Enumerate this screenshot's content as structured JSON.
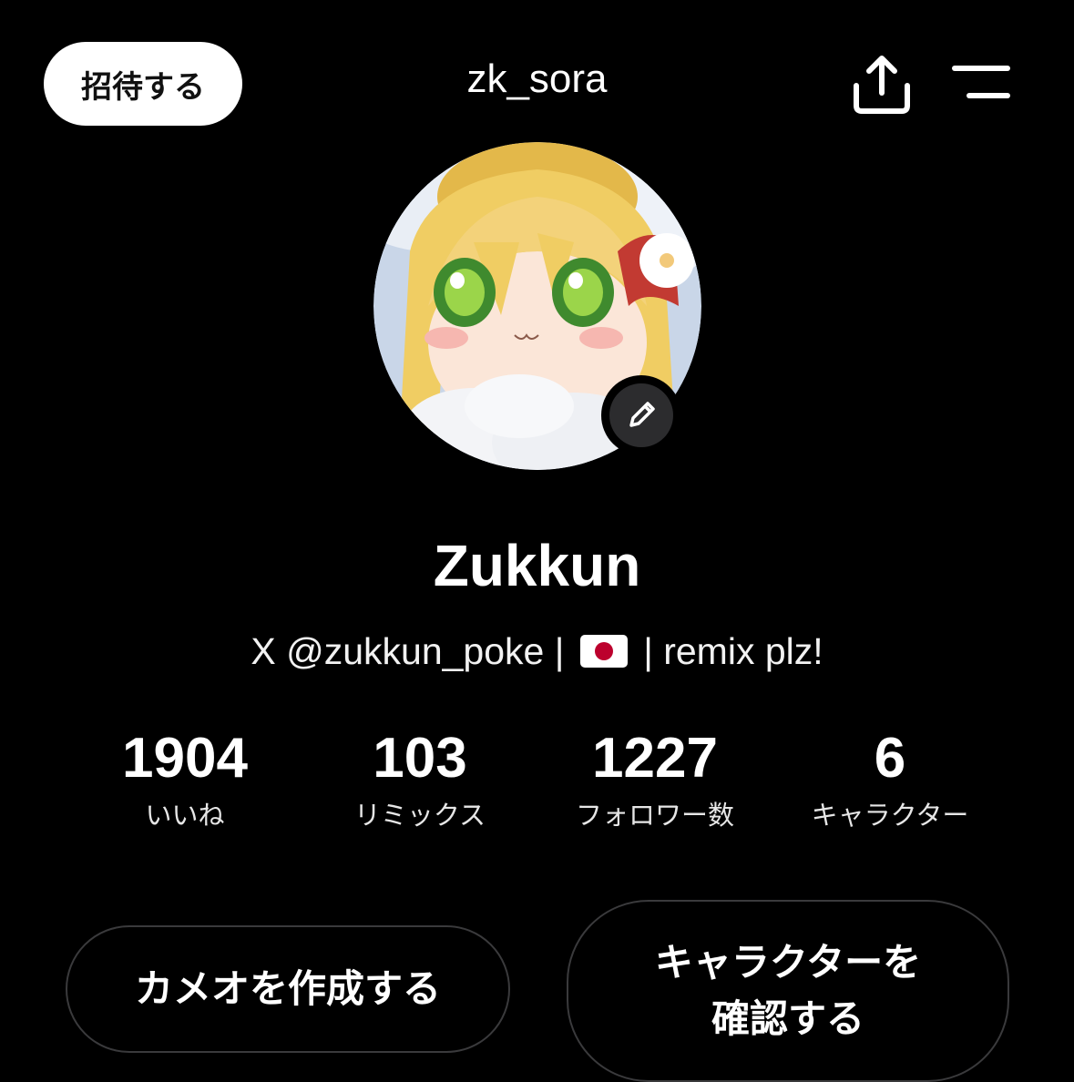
{
  "header": {
    "invite_label": "招待する",
    "username": "zk_sora",
    "share_icon": "share-icon",
    "menu_icon": "menu-icon"
  },
  "profile": {
    "display_name": "Zukkun",
    "bio_prefix": "X @zukkun_poke |",
    "bio_flag": "japan-flag-icon",
    "bio_suffix": "| remix plz!",
    "avatar": "anime-girl-avatar",
    "edit_icon": "pencil-icon"
  },
  "stats": [
    {
      "value": "1904",
      "label": "いいね"
    },
    {
      "value": "103",
      "label": "リミックス"
    },
    {
      "value": "1227",
      "label": "フォロワー数"
    },
    {
      "value": "6",
      "label": "キャラクター"
    }
  ],
  "actions": {
    "create_cameo": "カメオを作成する",
    "check_characters_line1": "キャラクターを",
    "check_characters_line2": "確認する"
  },
  "colors": {
    "background": "#000000",
    "button_border": "#3a3a3c",
    "edit_badge": "#2c2c2e"
  }
}
